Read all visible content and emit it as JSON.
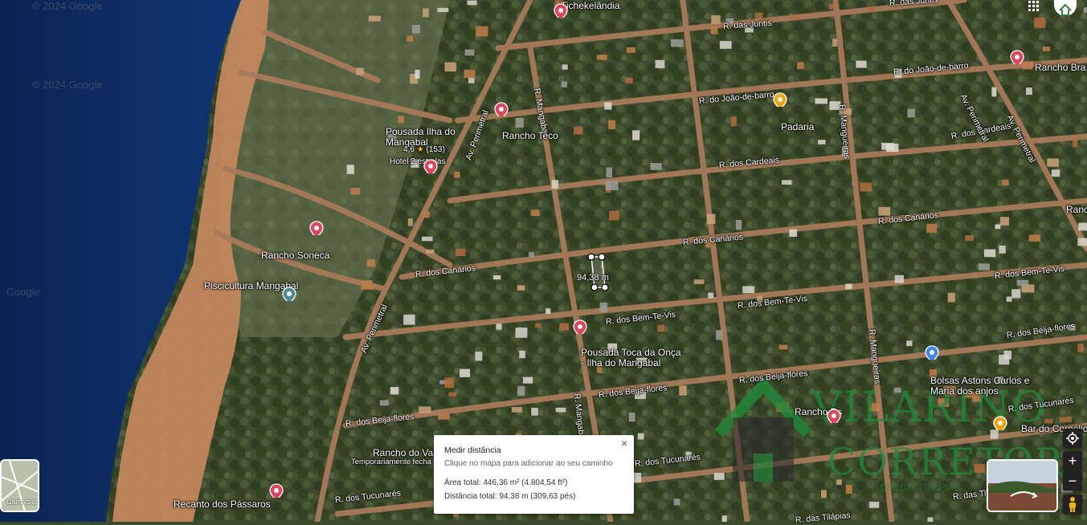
{
  "map": {
    "watermarks": [
      "© 2024 Google",
      "© 2024 Google",
      "Google"
    ],
    "streets": [
      "R. das Juritis",
      "R. das Juritis",
      "R. do João-de-barro",
      "R. do João-de-barro",
      "R. dos Cardeais",
      "R. dos Cardeais",
      "R. dos Canários",
      "R. dos Canários",
      "R. dos Canários",
      "R. dos Bem-Te-Vis",
      "R. dos Bem-Te-Vis",
      "R. dos Bem-Te-Vis",
      "R. dos Beija-flores",
      "R. dos Beija-flores",
      "R. dos Beija-flores",
      "R. dos Beija-flores",
      "R. dos Tucunarés",
      "R. dos Tucunarés",
      "R. dos Tucunarés",
      "R. das Tilápias",
      "R. das Tilápias",
      "Av. Perimetral",
      "Av. Perimetral",
      "Av. Perimetral",
      "Av. Perimetral",
      "R. Mangaba",
      "R. Mangaba",
      "R. Mangueiras",
      "R. Mangueiras"
    ],
    "pois": [
      "Tichekelândia",
      "Pousada Ilha do Mangabal",
      "Rancho Teco",
      "Padaria",
      "Rancho Bra",
      "Rancho Soneca",
      "Piscicultura Mangabal",
      "Pousada Toca da Onça - Ilha do Mangabal",
      "Rancho Ds",
      "Bolsas Astons Carlos e Maria dos anjos",
      "Rancho do Va",
      "Recanto dos Pássaros",
      "Bar do Cornélio",
      "Ranc"
    ],
    "poi_sub": {
      "rating": "4,6",
      "reviews": "(153)",
      "hotel": "Hotel 2 estrelas",
      "closed": "Temporariamente fecha"
    },
    "measure_label": "94,38 m",
    "colors": {
      "water": "#0b2a5c",
      "pin_red": "#e2445f",
      "pin_orange": "#f2a20c",
      "pin_blue": "#4285f4",
      "pin_teal": "#4b8b94",
      "watermark_green": "#1f8a3a"
    }
  },
  "watermark_brand": {
    "name": "VILARINO",
    "sub": "CORRETOR",
    "tag": "CRECI · TILÁPIAS"
  },
  "controls": {
    "zoom_in": "+",
    "zoom_out": "−",
    "locate_icon": "crosshair-icon",
    "layers_label": "Camadas",
    "apps_icon": "grid-icon"
  },
  "popup": {
    "title": "Medir distância",
    "hint": "Clique no mapa para adicionar ao seu caminho",
    "area": "Área total: 446,36 m² (4.804,54 ft²)",
    "distance": "Distância total: 94,38 m (309,63 pés)",
    "close": "×"
  }
}
